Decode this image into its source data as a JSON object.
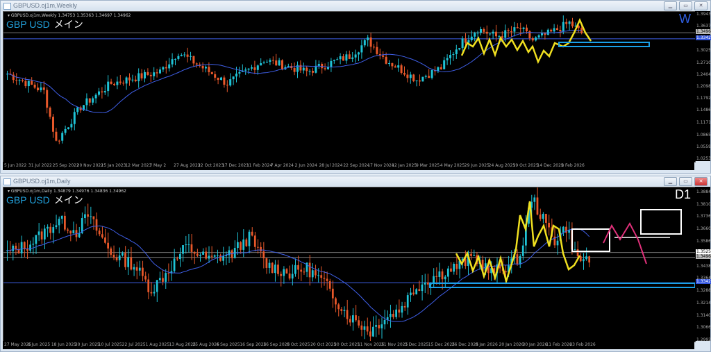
{
  "weekly": {
    "window_title": "GBPUSD.oj1m,Weekly",
    "ohlc": "▾ GBPUSD.oj1m,Weekly  1.34753 1.35363 1.34697 1.34962",
    "symbol": "GBP USD",
    "label_jp": "メイン",
    "timeframe": "W",
    "price_labels": [
      "1.39430",
      "1.36370",
      "1.30250",
      "1.27100",
      "1.24040",
      "1.20980",
      "1.17920",
      "1.14860",
      "1.11710",
      "1.08650",
      "1.05590",
      "1.02530"
    ],
    "current_price": "1.34962",
    "line_price": "1.33426",
    "date_labels": [
      "5 Jun 2022",
      "31 Jul 2022",
      "25 Sep 2022",
      "20 Nov 2022",
      "15 Jan 2023",
      "12 Mar 2023",
      "7 May 2",
      "27 Aug 2023",
      "22 Oct 2023",
      "17 Dec 2023",
      "11 Feb 2024",
      "7 Apr 2024",
      "2 Jun 2024",
      "28 Jul 2024",
      "22 Sep 2024",
      "17 Nov 2024",
      "12 Jan 2025",
      "9 Mar 2025",
      "4 May 2025",
      "29 Jun 2025",
      "24 Aug 2025",
      "19 Oct 2025",
      "14 Dec 2025",
      "8 Feb 2026"
    ],
    "range": [
      1.0253,
      1.3943
    ],
    "anchors": [
      [
        0,
        1.245
      ],
      [
        12,
        1.2
      ],
      [
        16,
        1.07
      ],
      [
        24,
        1.16
      ],
      [
        34,
        1.22
      ],
      [
        50,
        1.25
      ],
      [
        56,
        1.3
      ],
      [
        62,
        1.27
      ],
      [
        72,
        1.22
      ],
      [
        84,
        1.28
      ],
      [
        98,
        1.25
      ],
      [
        112,
        1.29
      ],
      [
        118,
        1.33
      ],
      [
        124,
        1.28
      ],
      [
        134,
        1.23
      ],
      [
        142,
        1.26
      ],
      [
        148,
        1.32
      ],
      [
        154,
        1.36
      ],
      [
        160,
        1.34
      ],
      [
        168,
        1.36
      ],
      [
        172,
        1.33
      ],
      [
        178,
        1.35
      ],
      [
        184,
        1.375
      ],
      [
        188,
        1.349
      ]
    ]
  },
  "daily": {
    "window_title": "GBPUSD.oj1m,Daily",
    "ohlc": "▾ GBPUSD.oj1m,Daily  1.34879 1.34976 1.34836 1.34962",
    "symbol": "GBP USD",
    "label_jp": "メイン",
    "timeframe": "D1",
    "price_labels": [
      "1.38840",
      "1.38100",
      "1.37360",
      "1.36600",
      "1.35860",
      "1.34380",
      "1.33640",
      "1.32880",
      "1.32140",
      "1.31400",
      "1.30660",
      "1.29920"
    ],
    "current_price": "1.34962",
    "upper_line_price": "1.35256",
    "line_price": "1.33426",
    "date_labels": [
      "27 May 2025",
      "6 Jun 2025",
      "18 Jun 2025",
      "30 Jun 2025",
      "10 Jul 2025",
      "22 Jul 2025",
      "1 Aug 2025",
      "13 Aug 2025",
      "25 Aug 2025",
      "4 Sep 2025",
      "16 Sep 2025",
      "26 Sep 2025",
      "8 Oct 2025",
      "20 Oct 2025",
      "30 Oct 2025",
      "11 Nov 2025",
      "21 Nov 2025",
      "3 Dec 2025",
      "15 Dec 2025",
      "26 Dec 2025",
      "8 Jan 2026",
      "20 Jan 2026",
      "30 Jan 2026",
      "11 Feb 2026",
      "23 Feb 2026"
    ],
    "range": [
      1.2992,
      1.3884
    ],
    "anchors": [
      [
        0,
        1.352
      ],
      [
        8,
        1.358
      ],
      [
        18,
        1.372
      ],
      [
        24,
        1.365
      ],
      [
        28,
        1.375
      ],
      [
        36,
        1.352
      ],
      [
        44,
        1.345
      ],
      [
        50,
        1.33
      ],
      [
        56,
        1.342
      ],
      [
        62,
        1.356
      ],
      [
        70,
        1.348
      ],
      [
        78,
        1.352
      ],
      [
        84,
        1.362
      ],
      [
        90,
        1.345
      ],
      [
        98,
        1.34
      ],
      [
        104,
        1.343
      ],
      [
        110,
        1.334
      ],
      [
        118,
        1.315
      ],
      [
        126,
        1.305
      ],
      [
        130,
        1.312
      ],
      [
        136,
        1.318
      ],
      [
        142,
        1.332
      ],
      [
        148,
        1.338
      ],
      [
        156,
        1.344
      ],
      [
        162,
        1.35
      ],
      [
        168,
        1.34
      ],
      [
        174,
        1.345
      ],
      [
        178,
        1.35
      ],
      [
        182,
        1.386
      ],
      [
        186,
        1.372
      ],
      [
        190,
        1.36
      ],
      [
        194,
        1.368
      ],
      [
        198,
        1.348
      ],
      [
        202,
        1.349
      ]
    ]
  },
  "colors": {
    "up": "#1fc3d6",
    "down": "#e8582a",
    "ma": "#3f5fe8",
    "zigzag": "#f0e020",
    "zone": "#1aa0e8",
    "forecast": "#e0307a"
  }
}
